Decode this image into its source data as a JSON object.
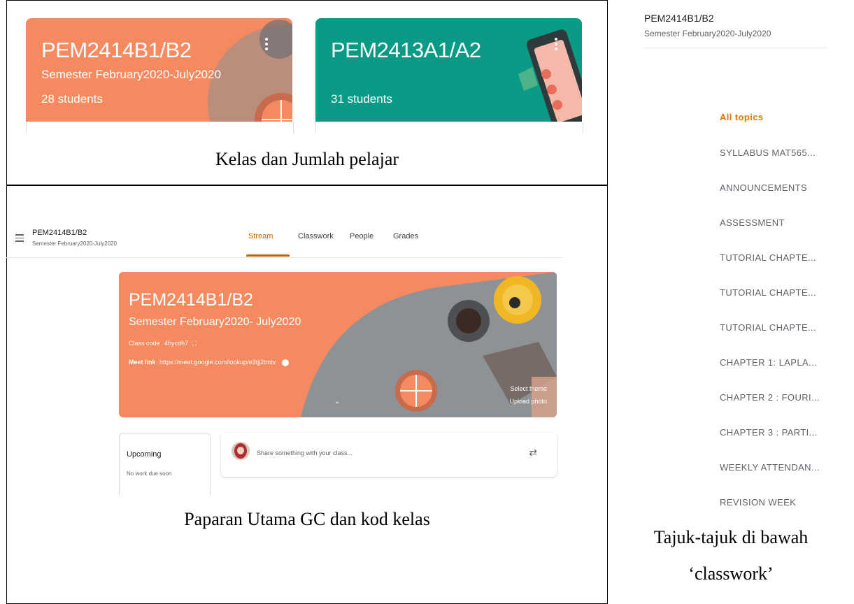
{
  "top_panel": {
    "cards": [
      {
        "title": "PEM2414B1/B2",
        "subtitle": "Semester February2020-July2020",
        "students": "28 students",
        "color": "#f5895f"
      },
      {
        "title": "PEM2413A1/A2",
        "subtitle": "",
        "students": "31 students",
        "color": "#0a9a86"
      }
    ],
    "caption": "Kelas dan Jumlah pelajar"
  },
  "gc_main": {
    "class_name": "PEM2414B1/B2",
    "semester": "Semester February2020-July2020",
    "tabs": [
      "Stream",
      "Classwork",
      "People",
      "Grades"
    ],
    "active_tab": "Stream",
    "banner": {
      "title": "PEM2414B1/B2",
      "subtitle": "Semester February2020- July2020",
      "class_code_label": "Class code",
      "class_code": "4hycdh7",
      "meet_label": "Meet link",
      "meet_url": "https://meet.google.com/lookup/e3tjj2tmtv",
      "select_theme": "Select theme",
      "upload_photo": "Upload photo"
    },
    "upcoming": {
      "title": "Upcoming",
      "empty": "No work due soon"
    },
    "share_placeholder": "Share something with your class...",
    "caption": "Paparan Utama GC dan kod kelas"
  },
  "sidebar": {
    "class_name": "PEM2414B1/B2",
    "semester": "Semester February2020-July2020",
    "topics": [
      "All topics",
      "SYLLABUS MAT565...",
      "ANNOUNCEMENTS",
      "ASSESSMENT",
      "TUTORIAL CHAPTE...",
      "TUTORIAL CHAPTE...",
      "TUTORIAL CHAPTE...",
      "CHAPTER 1: LAPLA...",
      "CHAPTER 2 : FOURI...",
      "CHAPTER 3 : PARTI...",
      "WEEKLY ATTENDAN...",
      "REVISION WEEK"
    ],
    "active_topic_color": "#e37400",
    "caption_line1": "Tajuk-tajuk di bawah",
    "caption_line2": "‘classwork’"
  }
}
